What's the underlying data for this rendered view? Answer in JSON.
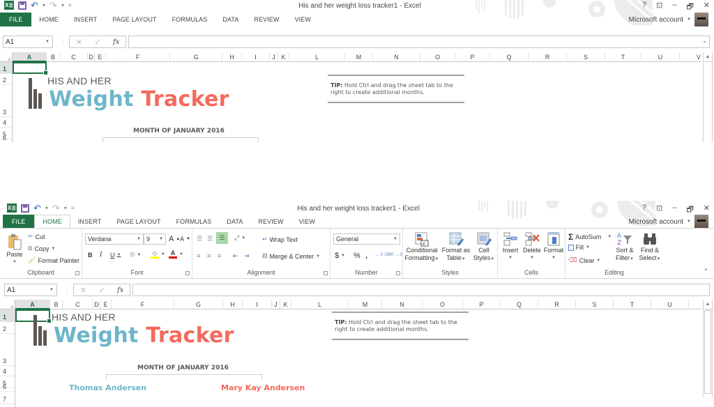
{
  "app": {
    "title": "His and her weight loss tracker1 - Excel",
    "account_label": "Microsoft account",
    "window_controls": [
      "?",
      "⊡",
      "–",
      "🗗",
      "✕"
    ],
    "qat": {
      "excel_icon": "X≣",
      "undo": "↶",
      "redo": "↷",
      "dropdown": "▾",
      "customize": "≡"
    }
  },
  "tabs": [
    {
      "label": "FILE"
    },
    {
      "label": "HOME"
    },
    {
      "label": "INSERT"
    },
    {
      "label": "PAGE LAYOUT"
    },
    {
      "label": "FORMULAS"
    },
    {
      "label": "DATA"
    },
    {
      "label": "REVIEW"
    },
    {
      "label": "VIEW"
    }
  ],
  "ribbon": {
    "clipboard": {
      "label": "Clipboard",
      "paste": "Paste",
      "cut": "Cut",
      "copy": "Copy",
      "format_painter": "Format Painter"
    },
    "font": {
      "label": "Font",
      "font_name": "Verdana",
      "font_size": "9",
      "grow": "A",
      "shrink": "A",
      "bold": "B",
      "italic": "I",
      "underline": "U",
      "fill_color": "#ffff00",
      "font_color": "#e00000"
    },
    "alignment": {
      "label": "Alignment",
      "wrap_text": "Wrap Text",
      "merge_center": "Merge & Center"
    },
    "number": {
      "label": "Number",
      "format": "General",
      "currency": "$",
      "percent": "%",
      "comma": ",",
      "inc_decimal": "←.0 .00",
      "dec_decimal": ".00 →.0"
    },
    "styles": {
      "label": "Styles",
      "conditional_formatting": [
        "Conditional",
        "Formatting"
      ],
      "format_as_table": [
        "Format as",
        "Table"
      ],
      "cell_styles": [
        "Cell",
        "Styles"
      ]
    },
    "cells": {
      "label": "Cells",
      "insert": "Insert",
      "delete": "Delete",
      "format": "Format"
    },
    "editing": {
      "label": "Editing",
      "autosum": "AutoSum",
      "fill": "Fill",
      "clear": "Clear",
      "sort_filter": [
        "Sort &",
        "Filter"
      ],
      "find_select": [
        "Find &",
        "Select"
      ]
    }
  },
  "formula_bar": {
    "name_box": "A1",
    "cancel": "✕",
    "enter": "✓",
    "fx": "fx",
    "value": ""
  },
  "grid": {
    "columns": [
      "A",
      "B",
      "C",
      "D",
      "E",
      "F",
      "G",
      "H",
      "I",
      "J",
      "K",
      "L",
      "M",
      "N",
      "O",
      "P",
      "Q",
      "R",
      "S",
      "T",
      "U",
      "V"
    ],
    "rows_top": [
      "1",
      "2",
      "3",
      "4",
      "5",
      "6"
    ],
    "rows_bottom": [
      "1",
      "2",
      "3",
      "4",
      "5",
      "6",
      "7"
    ],
    "selected_cell": "A1"
  },
  "sheet": {
    "subtitle": "HIS AND HER",
    "title_part1": "Weight",
    "title_part2": "Tracker",
    "month": "MONTH OF JANUARY 2016",
    "tip_label": "TIP:",
    "tip_text": " Hold Ctrl and drag the sheet tab to the right to create additional months.",
    "his_name": "Thomas Andersen",
    "her_name": "Mary Kay Andersen",
    "colors": {
      "his": "#6db6c9",
      "her": "#f46a5c",
      "logo": "#5e5650",
      "accent": "#217346"
    }
  }
}
